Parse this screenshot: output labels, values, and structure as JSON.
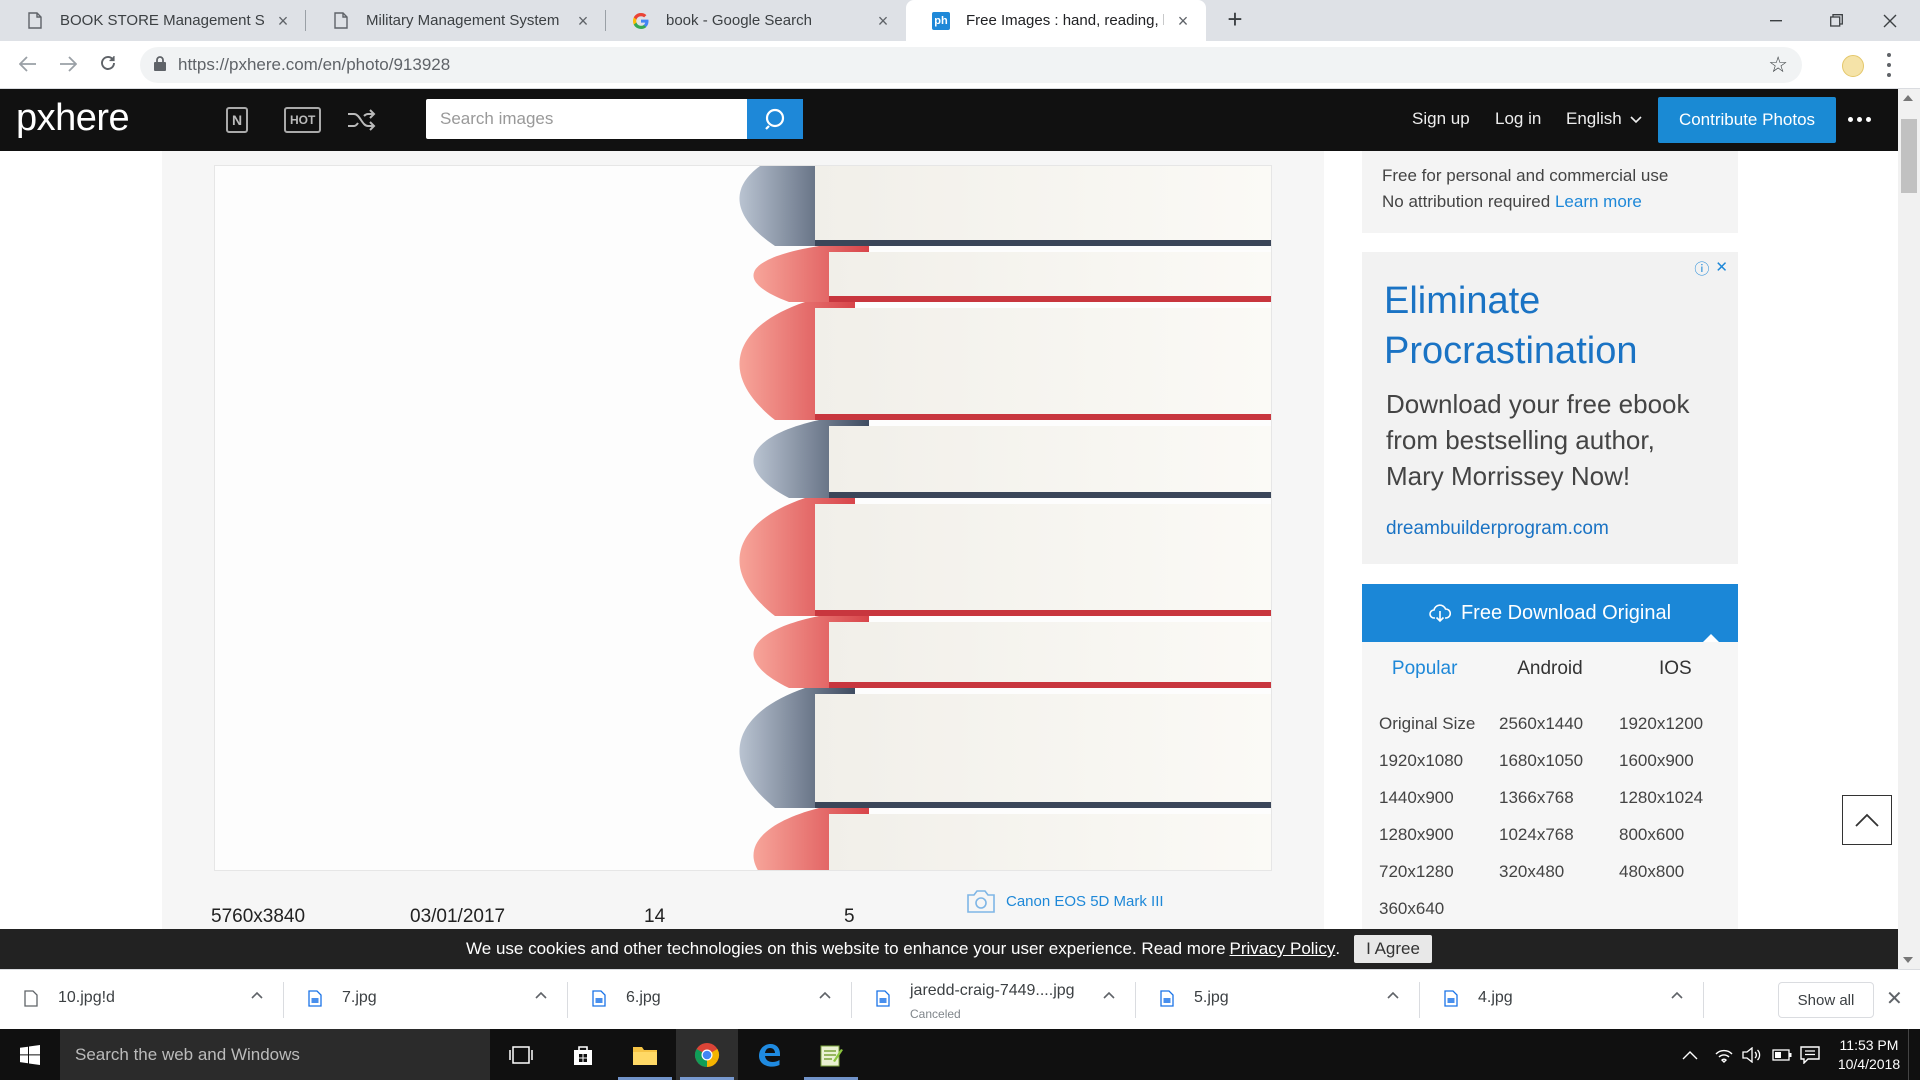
{
  "browser": {
    "tabs": [
      {
        "label": "BOOK STORE Management Syste",
        "icon": "document-icon"
      },
      {
        "label": "Military Management System",
        "icon": "document-icon"
      },
      {
        "label": "book - Google Search",
        "icon": "google-icon"
      },
      {
        "label": "Free Images : hand, reading, line,",
        "icon": "pxhere-icon",
        "favicon_text": "ph",
        "active": true
      }
    ],
    "url": "https://pxhere.com/en/photo/913928"
  },
  "site": {
    "logo": "pxhere",
    "nav_icons": {
      "new": "N",
      "hot": "HOT"
    },
    "search": {
      "placeholder": "Search images"
    },
    "signup": "Sign up",
    "login": "Log in",
    "language": "English",
    "contribute": "Contribute Photos"
  },
  "photo": {
    "dimensions": "5760x3840",
    "date": "03/01/2017",
    "stat1": "14",
    "stat2": "5",
    "camera": "Canon EOS 5D Mark III"
  },
  "license": {
    "line1": "Free for personal and commercial use",
    "line2": "No attribution required",
    "learn_more": "Learn more"
  },
  "ad": {
    "title_line1": "Eliminate",
    "title_line2": "Procrastination",
    "text_line1": "Download your free ebook",
    "text_line2": "from bestselling author,",
    "text_line3": "Mary Morrissey Now!",
    "link": "dreambuilderprogram.com"
  },
  "download": {
    "button": "Free Download Original",
    "tabs": [
      "Popular",
      "Android",
      "IOS"
    ],
    "sizes": [
      "Original Size",
      "2560x1440",
      "1920x1200",
      "1920x1080",
      "1680x1050",
      "1600x900",
      "1440x900",
      "1366x768",
      "1280x1024",
      "1280x900",
      "1024x768",
      "800x600",
      "720x1280",
      "320x480",
      "480x800",
      "360x640"
    ]
  },
  "cookie": {
    "text": "We use cookies and other technologies on this website to enhance your user experience. Read more",
    "policy": "Privacy Policy",
    "agree": "I Agree"
  },
  "downloads_shelf": {
    "items": [
      {
        "name": "10.jpg!d",
        "status": ""
      },
      {
        "name": "7.jpg",
        "status": ""
      },
      {
        "name": "6.jpg",
        "status": ""
      },
      {
        "name": "jaredd-craig-7449....jpg",
        "status": "Canceled"
      },
      {
        "name": "5.jpg",
        "status": ""
      },
      {
        "name": "4.jpg",
        "status": ""
      }
    ],
    "show_all": "Show all"
  },
  "taskbar": {
    "search_placeholder": "Search the web and Windows",
    "time": "11:53 PM",
    "date": "10/4/2018"
  },
  "colors": {
    "accent": "#1a8ad4",
    "header_bg": "#111111",
    "ad_link": "#1a73c4"
  }
}
